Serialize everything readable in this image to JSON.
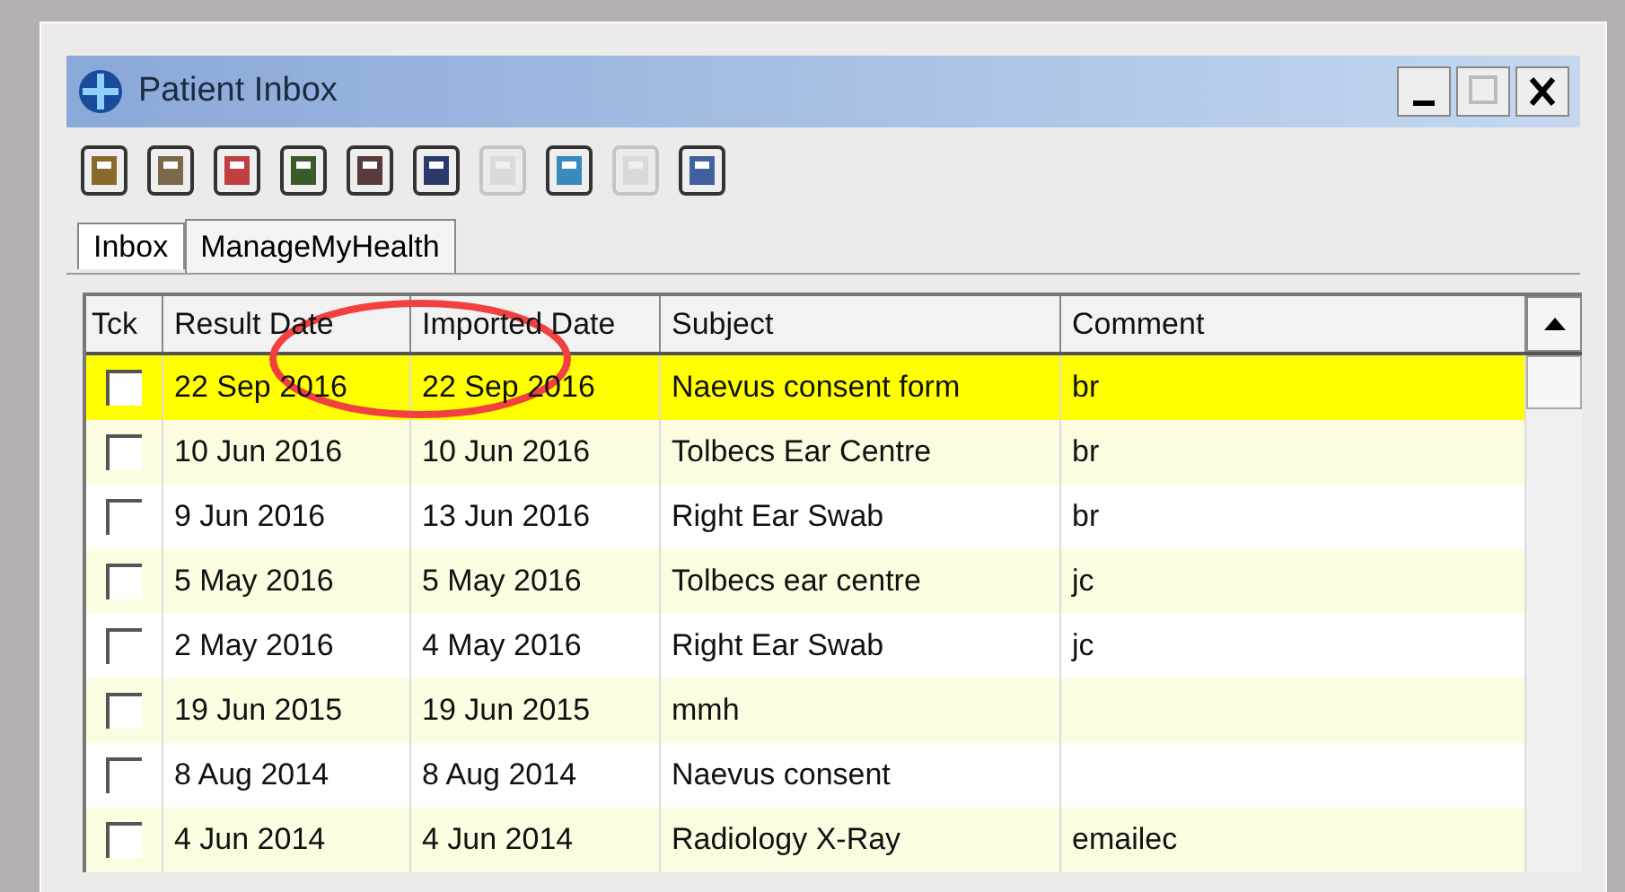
{
  "window": {
    "title": "Patient Inbox"
  },
  "toolbar": [
    {
      "disabled": false
    },
    {
      "disabled": false
    },
    {
      "disabled": false
    },
    {
      "disabled": false
    },
    {
      "disabled": false
    },
    {
      "disabled": false
    },
    {
      "disabled": true
    },
    {
      "disabled": false
    },
    {
      "disabled": true
    },
    {
      "disabled": false
    }
  ],
  "tabs": [
    {
      "label": "Inbox",
      "selected": true
    },
    {
      "label": "ManageMyHealth",
      "selected": false
    }
  ],
  "table": {
    "columns": [
      "Tck",
      "Result Date",
      "Imported Date",
      "Subject",
      "Comment"
    ],
    "rows": [
      {
        "checked": false,
        "selected": true,
        "result_date": "22 Sep 2016",
        "imported_date": "22 Sep 2016",
        "subject": "Naevus consent form",
        "comment": "br"
      },
      {
        "checked": false,
        "selected": false,
        "result_date": "10 Jun 2016",
        "imported_date": "10 Jun 2016",
        "subject": "Tolbecs Ear Centre",
        "comment": "br"
      },
      {
        "checked": false,
        "selected": false,
        "result_date": "9 Jun 2016",
        "imported_date": "13 Jun 2016",
        "subject": "Right Ear Swab",
        "comment": "br"
      },
      {
        "checked": false,
        "selected": false,
        "result_date": "5 May 2016",
        "imported_date": "5 May 2016",
        "subject": "Tolbecs ear centre",
        "comment": "jc"
      },
      {
        "checked": false,
        "selected": false,
        "result_date": "2 May 2016",
        "imported_date": "4 May 2016",
        "subject": "Right Ear Swab",
        "comment": "jc"
      },
      {
        "checked": false,
        "selected": false,
        "result_date": "19 Jun 2015",
        "imported_date": "19 Jun 2015",
        "subject": "mmh"
      },
      {
        "checked": false,
        "selected": false,
        "result_date": "8 Aug 2014",
        "imported_date": "8 Aug 2014",
        "subject": "Naevus consent"
      },
      {
        "checked": false,
        "selected": false,
        "result_date": "4 Jun 2014",
        "imported_date": "4 Jun 2014",
        "subject": "Radiology X-Ray",
        "comment": "emailec"
      }
    ]
  }
}
